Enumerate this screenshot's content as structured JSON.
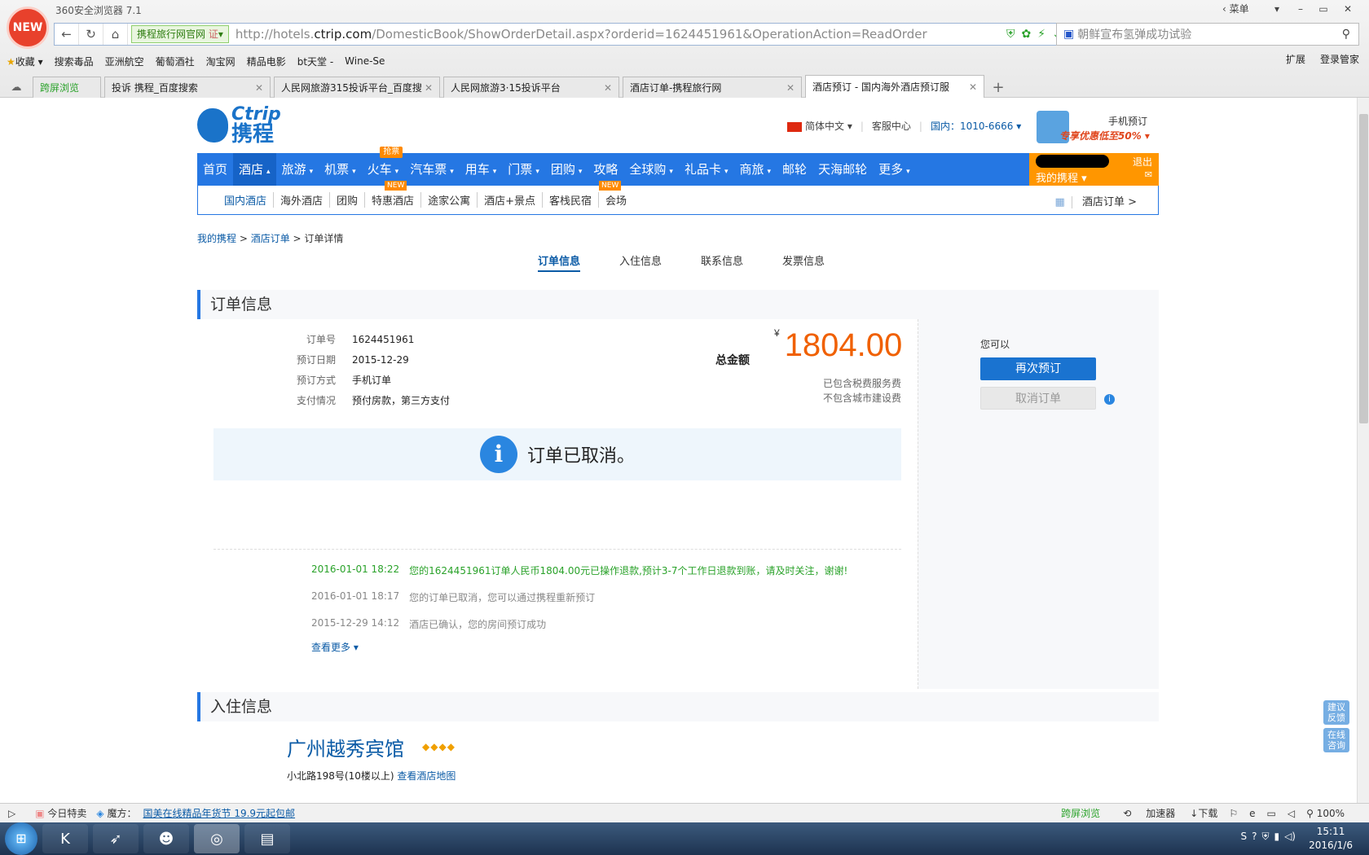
{
  "browser": {
    "title": "360安全浏览器 7.1",
    "new_badge": "NEW",
    "site_badge": "携程旅行网官网",
    "url_prefix": "http://hotels.",
    "url_domain": "ctrip.com",
    "url_path": "/DomesticBook/ShowOrderDetail.aspx?orderid=1624451961&OperationAction=ReadOrder",
    "search_text": "朝鲜宣布氢弹成功试验",
    "menu_label": "菜单",
    "bookmarks": [
      "收藏",
      "搜索毒品",
      "亚洲航空",
      "葡萄酒社",
      "淘宝网",
      "精品电影",
      "bt天堂 -",
      "Wine-Se"
    ],
    "bookmark_right": [
      "扩展",
      "登录管家"
    ],
    "tabs": [
      {
        "label": "跨屏浏览"
      },
      {
        "label": "投诉 携程_百度搜索"
      },
      {
        "label": "人民网旅游315投诉平台_百度搜"
      },
      {
        "label": "人民网旅游3·15投诉平台"
      },
      {
        "label": "酒店订单-携程旅行网"
      },
      {
        "label": "酒店预订 - 国内海外酒店预订服"
      }
    ]
  },
  "site": {
    "logo_en": "Ctrip",
    "logo_cn": "携程",
    "lang": "简体中文",
    "service": "客服中心",
    "phone": "国内：1010-6666",
    "mobile_title": "手机预订",
    "mobile_promo": "专享优惠低至50%",
    "nav": [
      {
        "label": "首页"
      },
      {
        "label": "酒店"
      },
      {
        "label": "旅游"
      },
      {
        "label": "机票"
      },
      {
        "label": "火车"
      },
      {
        "label": "汽车票"
      },
      {
        "label": "用车"
      },
      {
        "label": "门票"
      },
      {
        "label": "团购"
      },
      {
        "label": "攻略"
      },
      {
        "label": "全球购"
      },
      {
        "label": "礼品卡"
      },
      {
        "label": "商旅"
      },
      {
        "label": "邮轮"
      },
      {
        "label": "天海邮轮"
      },
      {
        "label": "更多"
      }
    ],
    "hot_badge": "抢票",
    "user_my": "我的携程",
    "user_logout": "退出",
    "subnav": [
      "国内酒店",
      "海外酒店",
      "团购",
      "特惠酒店",
      "途家公寓",
      "酒店+景点",
      "客栈民宿",
      "会场"
    ],
    "new_label": "NEW",
    "hotel_orders_link": "酒店订单 >"
  },
  "breadcrumb": {
    "home": "我的携程",
    "orders": "酒店订单",
    "current": "订单详情"
  },
  "order_tabs": [
    "订单信息",
    "入住信息",
    "联系信息",
    "发票信息"
  ],
  "order": {
    "section_title": "订单信息",
    "fields": [
      {
        "k": "订单号",
        "v": "1624451961"
      },
      {
        "k": "预订日期",
        "v": "2015-12-29"
      },
      {
        "k": "预订方式",
        "v": "手机订单"
      },
      {
        "k": "支付情况",
        "v": "预付房款，第三方支付"
      }
    ],
    "amount_label": "总金额",
    "currency": "¥",
    "amount": "1804.00",
    "note1": "已包含税费服务费",
    "note2": "不包含城市建设费",
    "status": "订单已取消。",
    "logs": [
      {
        "time": "2016-01-01 18:22",
        "text": "您的1624451961订单人民币1804.00元已操作退款,预计3-7个工作日退款到账，请及时关注，谢谢!"
      },
      {
        "time": "2016-01-01 18:17",
        "text": "您的订单已取消，您可以通过携程重新预订"
      },
      {
        "time": "2015-12-29 14:12",
        "text": "酒店已确认，您的房间预订成功"
      }
    ],
    "more": "查看更多",
    "actions_title": "您可以",
    "rebook": "再次预订",
    "cancel": "取消订单"
  },
  "checkin": {
    "section_title": "入住信息",
    "hotel_name": "广州越秀宾馆",
    "stars": 4,
    "address": "小北路198号(10楼以上)",
    "map_link": "查看酒店地图"
  },
  "feedback": [
    "建议反馈",
    "在线咨询"
  ],
  "statusbar": {
    "items_left": [
      "今日特卖",
      "魔方："
    ],
    "ad": "国美在线精品年货节 19.9元起包邮",
    "items_right": [
      "跨屏浏览",
      "加速器",
      "下载",
      "100%"
    ]
  },
  "taskbar": {
    "time": "15:11",
    "date": "2016/1/6"
  }
}
